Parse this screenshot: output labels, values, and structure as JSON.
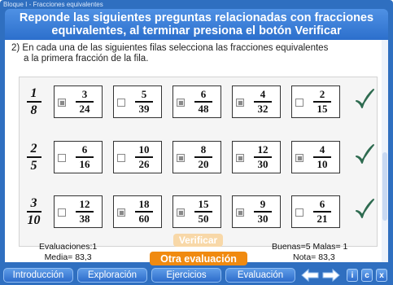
{
  "window": {
    "title": "Bloque I - Fracciones equivalentes"
  },
  "banner": {
    "line1": "Reponde las siguientes preguntas relacionadas con fracciones",
    "line2": "equivalentes, al terminar presiona el botón Verificar"
  },
  "question": {
    "line1": "2) En cada una de las siguientes filas selecciona las fracciones equivalentes",
    "line2": "a la primera fracción de la fila."
  },
  "rows": [
    {
      "lead": {
        "num": "1",
        "den": "8"
      },
      "options": [
        {
          "num": "3",
          "den": "24",
          "checked": true
        },
        {
          "num": "5",
          "den": "39",
          "checked": false
        },
        {
          "num": "6",
          "den": "48",
          "checked": true
        },
        {
          "num": "4",
          "den": "32",
          "checked": true
        },
        {
          "num": "2",
          "den": "15",
          "checked": false
        }
      ],
      "result": "correct"
    },
    {
      "lead": {
        "num": "2",
        "den": "5"
      },
      "options": [
        {
          "num": "6",
          "den": "16",
          "checked": false
        },
        {
          "num": "10",
          "den": "26",
          "checked": false
        },
        {
          "num": "8",
          "den": "20",
          "checked": true
        },
        {
          "num": "12",
          "den": "30",
          "checked": true
        },
        {
          "num": "4",
          "den": "10",
          "checked": true
        }
      ],
      "result": "correct"
    },
    {
      "lead": {
        "num": "3",
        "den": "10"
      },
      "options": [
        {
          "num": "12",
          "den": "38",
          "checked": false
        },
        {
          "num": "18",
          "den": "60",
          "checked": true
        },
        {
          "num": "15",
          "den": "50",
          "checked": true
        },
        {
          "num": "9",
          "den": "30",
          "checked": true
        },
        {
          "num": "6",
          "den": "21",
          "checked": false
        }
      ],
      "result": "correct"
    }
  ],
  "stats": {
    "evaluaciones": "Evaluaciones:1",
    "media": "Media= 83,3",
    "buenas_malas": "Buenas=5  Malas= 1",
    "nota": "Nota= 83,3"
  },
  "buttons": {
    "verificar": "Verificar",
    "otra": "Otra evaluación"
  },
  "nav": {
    "tabs": [
      "Introducción",
      "Exploración",
      "Ejercicios",
      "Evaluación"
    ],
    "small": [
      "i",
      "c",
      "x"
    ]
  },
  "colors": {
    "accent": "#2f6fc0",
    "orange": "#f08a10",
    "check": "#2e6b50"
  }
}
